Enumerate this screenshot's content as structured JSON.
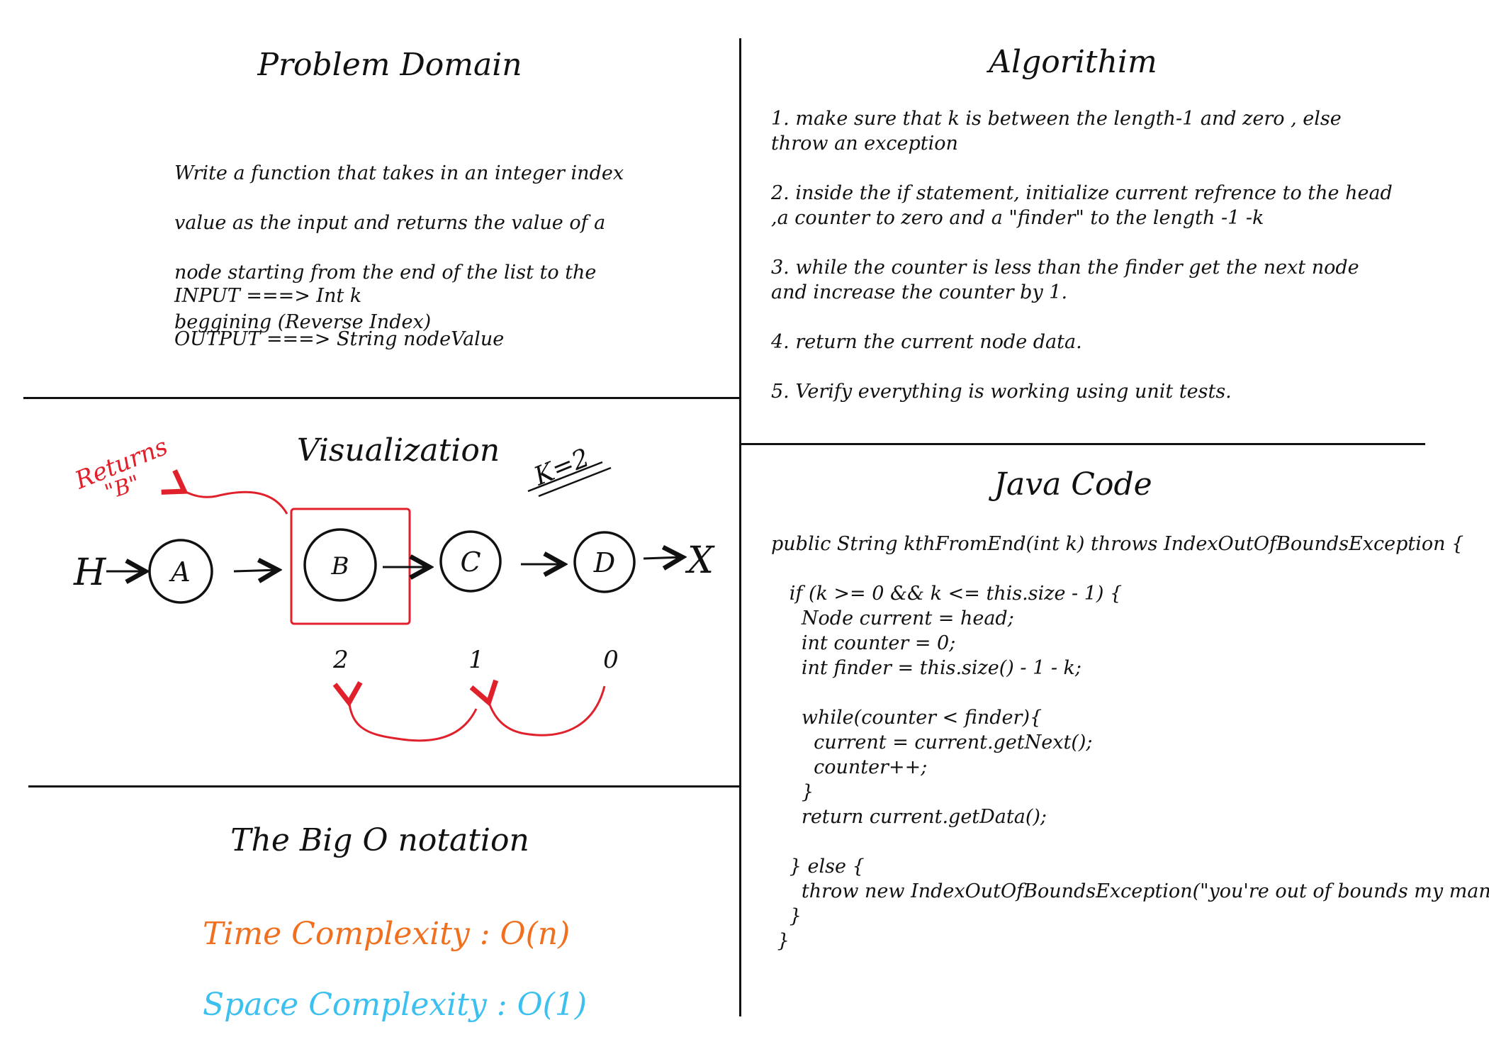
{
  "colors": {
    "ink": "#111111",
    "annotation": "#e0202a",
    "time": "#f07020",
    "space": "#3cc0f0"
  },
  "problem_domain": {
    "title": "Problem Domain",
    "description_lines": [
      "Write a function that takes in an integer index",
      "value as the input and returns the value of a",
      "node starting from the end of the list to the",
      "beggining (Reverse Index)"
    ],
    "input": "INPUT ===> Int k",
    "output": "OUTPUT ===> String nodeValue"
  },
  "algorithm": {
    "title": "Algorithim",
    "steps": [
      "1. make sure that k is between the length-1 and zero , else throw an exception",
      "2. inside the if statement, initialize current refrence to the head ,a counter to zero and a \"finder\" to the length -1 -k",
      "3. while the counter is less than the finder get the next node and increase the counter by 1.",
      "4. return the current node data.",
      "5. Verify everything is working using unit tests."
    ]
  },
  "visualization": {
    "title": "Visualization",
    "head_label": "H",
    "nodes": [
      "A",
      "B",
      "C",
      "D"
    ],
    "tail_label": "X",
    "indices": [
      "2",
      "1",
      "0"
    ],
    "k_label": "K=2",
    "returns_label": "Returns",
    "returns_value": "\"B\""
  },
  "big_o": {
    "title": "The Big O notation",
    "time": "Time Complexity : O(n)",
    "space": "Space Complexity : O(1)"
  },
  "java_code": {
    "title": "Java Code",
    "lines": [
      "public String kthFromEnd(int k) throws IndexOutOfBoundsException {",
      "",
      "   if (k >= 0 && k <= this.size - 1) {",
      "     Node current = head;",
      "     int counter = 0;",
      "     int finder = this.size() - 1 - k;",
      "",
      "     while(counter < finder){",
      "       current = current.getNext();",
      "       counter++;",
      "     }",
      "     return current.getData();",
      "",
      "   } else {",
      "     throw new IndexOutOfBoundsException(\"you're out of bounds my man\");",
      "   }",
      " }"
    ]
  }
}
